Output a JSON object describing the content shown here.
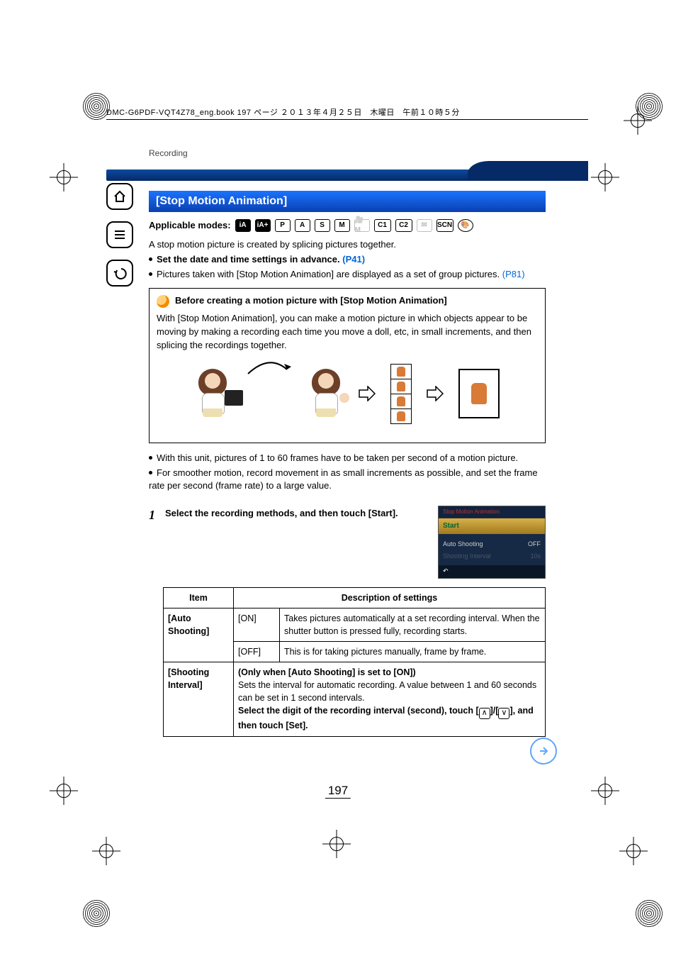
{
  "print_header": "DMC-G6PDF-VQT4Z78_eng.book  197 ページ  ２０１３年４月２５日　木曜日　午前１０時５分",
  "section": "Recording",
  "title": "[Stop Motion Animation]",
  "modes_label": "Applicable modes:",
  "mode_icons": [
    "iA",
    "iA+",
    "P",
    "A",
    "S",
    "M",
    "🎥M",
    "C1",
    "C2",
    "✉",
    "SCN",
    "🎨"
  ],
  "intro_line": "A stop motion picture is created by splicing pictures together.",
  "bullet_set_date_a": "Set the date and time settings in advance. ",
  "bullet_set_date_link": "(P41)",
  "bullet_group_a": "Pictures taken with [Stop Motion Animation] are displayed as a set of group pictures. ",
  "bullet_group_link": "(P81)",
  "info_title": "Before creating a motion picture with [Stop Motion Animation]",
  "info_body": "With [Stop Motion Animation], you can make a motion picture in which objects appear to be moving by making a recording each time you move a doll, etc, in small increments, and then splicing the recordings together.",
  "note1": "With this unit, pictures of 1 to 60 frames have to be taken per second of a motion picture.",
  "note2": "For smoother motion, record movement in as small increments as possible, and set the frame rate per second (frame rate) to a large value.",
  "step_num": "1",
  "step_text": "Select the recording methods, and then touch [Start].",
  "screenshot": {
    "title": "Stop Motion Animation",
    "start": "Start",
    "row1_label": "Auto Shooting",
    "row1_value": "OFF",
    "row2_label": "Shooting Interval",
    "row2_value": "10s"
  },
  "table": {
    "head_item": "Item",
    "head_desc": "Description of settings",
    "r1_item": "[Auto Shooting]",
    "r1_on": "[ON]",
    "r1_on_desc": "Takes pictures automatically at a set recording interval. When the shutter button is pressed fully, recording starts.",
    "r1_off": "[OFF]",
    "r1_off_desc": "This is for taking pictures manually, frame by frame.",
    "r2_item": "[Shooting Interval]",
    "r2_desc_a": "(Only when [Auto Shooting] is set to [ON])",
    "r2_desc_b": "Sets the interval for automatic recording. A value between 1 and 60 seconds can be set in 1 second intervals.",
    "r2_desc_c1": "Select the digit of the recording interval (second), touch [",
    "r2_desc_c_up": "∧",
    "r2_desc_c_mid": "]/[",
    "r2_desc_c_down": "∨",
    "r2_desc_c2": "], and then touch [Set]."
  },
  "page_number": "197"
}
